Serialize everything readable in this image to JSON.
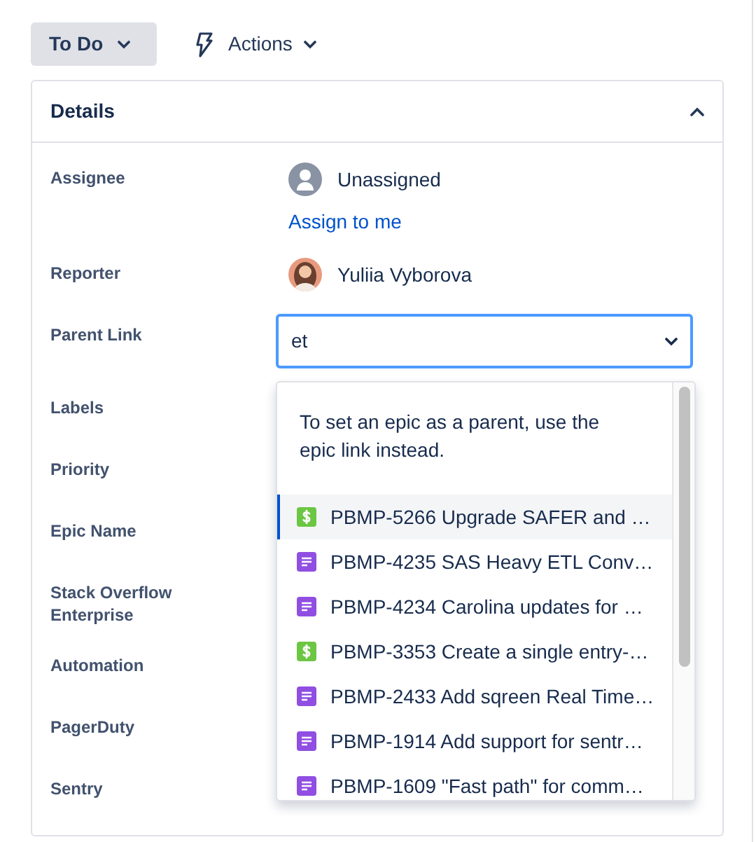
{
  "toolbar": {
    "status": "To Do",
    "actions": "Actions"
  },
  "details": {
    "title": "Details",
    "expanded": true,
    "fields": [
      {
        "label": "Assignee",
        "kind": "user",
        "photo": false,
        "value": "Unassigned",
        "link": "Assign to me"
      },
      {
        "label": "Reporter",
        "kind": "user",
        "photo": true,
        "value": "Yuliia Vyborova"
      },
      {
        "label": "Parent Link",
        "kind": "select",
        "value": "et",
        "focused": true
      },
      {
        "label": "Labels",
        "kind": "empty"
      },
      {
        "label": "Priority",
        "kind": "empty"
      },
      {
        "label": "Epic Name",
        "kind": "empty"
      },
      {
        "label": "Stack Overflow Enterprise",
        "kind": "empty"
      },
      {
        "label": "Automation",
        "kind": "empty"
      },
      {
        "label": "PagerDuty",
        "kind": "empty"
      },
      {
        "label": "Sentry",
        "kind": "empty"
      }
    ]
  },
  "dropdown": {
    "message": "To set an epic as a parent, use the epic link instead.",
    "options": [
      {
        "kind": "budget",
        "text": "PBMP-5266 Upgrade SAFER and …",
        "selected": true
      },
      {
        "kind": "task",
        "text": "PBMP-4235 SAS Heavy ETL Conv…",
        "selected": false
      },
      {
        "kind": "task",
        "text": "PBMP-4234 Carolina updates for …",
        "selected": false
      },
      {
        "kind": "budget",
        "text": "PBMP-3353 Create a single entry-…",
        "selected": false
      },
      {
        "kind": "task",
        "text": "PBMP-2433 Add sqreen Real Time…",
        "selected": false
      },
      {
        "kind": "task",
        "text": "PBMP-1914 Add support for sentr…",
        "selected": false
      },
      {
        "kind": "task",
        "text": "PBMP-1609 \"Fast path\" for comm…",
        "selected": false
      }
    ]
  }
}
